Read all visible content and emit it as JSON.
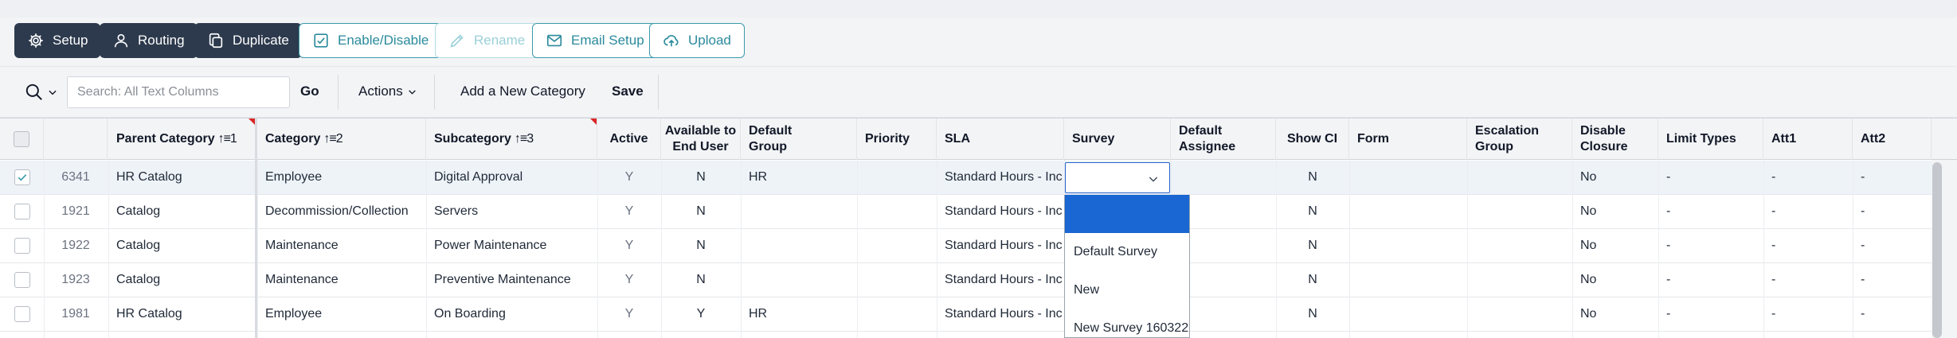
{
  "toolbar": {
    "buttons": [
      {
        "label": "Setup",
        "icon": "gear-icon",
        "style": "dark"
      },
      {
        "label": "Routing",
        "icon": "person-icon",
        "style": "dark"
      },
      {
        "label": "Duplicate",
        "icon": "copy-icon",
        "style": "dark"
      },
      {
        "label": "Enable/Disable",
        "icon": "checkbox-icon",
        "style": "outline"
      },
      {
        "label": "Rename",
        "icon": "pencil-icon",
        "style": "disabled"
      },
      {
        "label": "Email Setup",
        "icon": "envelope-icon",
        "style": "outline"
      },
      {
        "label": "Upload",
        "icon": "cloud-upload-icon",
        "style": "outline"
      }
    ]
  },
  "searchbar": {
    "placeholder": "Search: All Text Columns",
    "go_label": "Go",
    "actions_label": "Actions",
    "add_label": "Add a New Category",
    "save_label": "Save"
  },
  "columns": [
    {
      "key": "id",
      "label": ""
    },
    {
      "key": "parent",
      "label": "Parent Category",
      "sort": "↑≡1",
      "flag": true
    },
    {
      "key": "category",
      "label": "Category",
      "sort": "↑≡2",
      "flag": false
    },
    {
      "key": "subcategory",
      "label": "Subcategory",
      "sort": "↑≡3",
      "flag": true
    },
    {
      "key": "active",
      "label": "Active"
    },
    {
      "key": "available",
      "label": "Available to End User"
    },
    {
      "key": "group",
      "label": "Default Group"
    },
    {
      "key": "priority",
      "label": "Priority"
    },
    {
      "key": "sla",
      "label": "SLA"
    },
    {
      "key": "survey",
      "label": "Survey"
    },
    {
      "key": "assignee",
      "label": "Default Assignee"
    },
    {
      "key": "showci",
      "label": "Show CI"
    },
    {
      "key": "form",
      "label": "Form"
    },
    {
      "key": "escalation",
      "label": "Escalation Group"
    },
    {
      "key": "disable",
      "label": "Disable Closure"
    },
    {
      "key": "limit",
      "label": "Limit Types"
    },
    {
      "key": "att1",
      "label": "Att1"
    },
    {
      "key": "att2",
      "label": "Att2"
    }
  ],
  "rows": [
    {
      "checked": true,
      "id": "6341",
      "parent": "HR Catalog",
      "category": "Employee",
      "subcategory": "Digital Approval",
      "active": "Y",
      "available": "N",
      "group": "HR",
      "priority": "",
      "sla": "Standard Hours - Inc",
      "survey": "",
      "assignee": "",
      "showci": "N",
      "form": "",
      "escalation": "",
      "disable": "No",
      "limit": "-",
      "att1": "-",
      "att2": "-"
    },
    {
      "checked": false,
      "id": "1921",
      "parent": "Catalog",
      "category": "Decommission/Collection",
      "subcategory": "Servers",
      "active": "Y",
      "available": "N",
      "group": "",
      "priority": "",
      "sla": "Standard Hours - Inc",
      "survey": "",
      "assignee": "",
      "showci": "N",
      "form": "",
      "escalation": "",
      "disable": "No",
      "limit": "-",
      "att1": "-",
      "att2": "-"
    },
    {
      "checked": false,
      "id": "1922",
      "parent": "Catalog",
      "category": "Maintenance",
      "subcategory": "Power Maintenance",
      "active": "Y",
      "available": "N",
      "group": "",
      "priority": "",
      "sla": "Standard Hours - Inc",
      "survey": "",
      "assignee": "",
      "showci": "N",
      "form": "",
      "escalation": "",
      "disable": "No",
      "limit": "-",
      "att1": "-",
      "att2": "-"
    },
    {
      "checked": false,
      "id": "1923",
      "parent": "Catalog",
      "category": "Maintenance",
      "subcategory": "Preventive Maintenance",
      "active": "Y",
      "available": "N",
      "group": "",
      "priority": "",
      "sla": "Standard Hours - Inc",
      "survey": "",
      "assignee": "",
      "showci": "N",
      "form": "",
      "escalation": "",
      "disable": "No",
      "limit": "-",
      "att1": "-",
      "att2": "-"
    },
    {
      "checked": false,
      "id": "1981",
      "parent": "HR Catalog",
      "category": "Employee",
      "subcategory": "On Boarding",
      "active": "Y",
      "available": "Y",
      "group": "HR",
      "priority": "",
      "sla": "Standard Hours - Inc",
      "survey": "",
      "assignee": "",
      "showci": "N",
      "form": "",
      "escalation": "",
      "disable": "No",
      "limit": "-",
      "att1": "-",
      "att2": "-"
    }
  ],
  "survey_dropdown": {
    "selected": "",
    "options": [
      "",
      "Default Survey",
      "New",
      "New Survey 160322"
    ]
  },
  "colors": {
    "dark_button": "#2d3a4d",
    "accent_teal": "#2a8a9c",
    "dropdown_highlight": "#1a66d2",
    "sort_flag": "#dc2626"
  }
}
